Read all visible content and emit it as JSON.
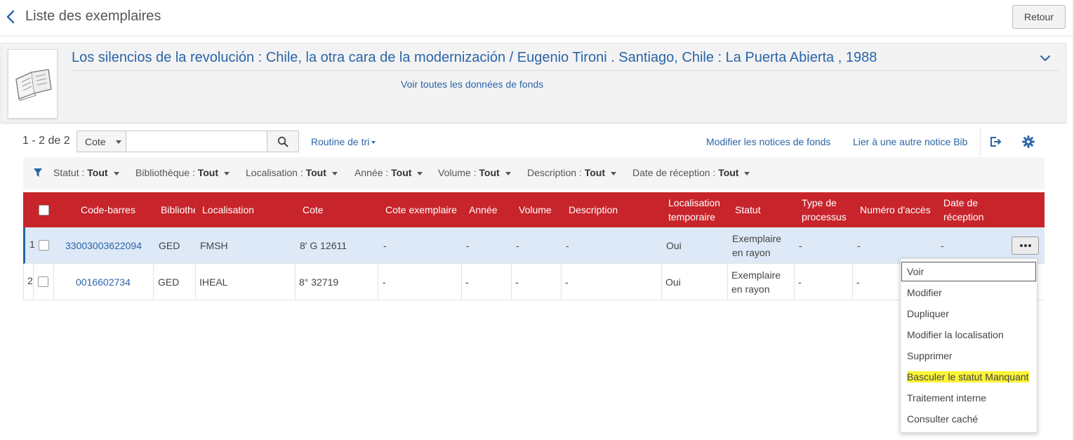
{
  "header": {
    "title": "Liste des exemplaires",
    "back_button": "Retour"
  },
  "bib": {
    "title": "Los silencios de la revolución : Chile, la otra cara de la modernización / Eugenio Tironi . Santiago, Chile : La Puerta Abierta , 1988",
    "holdings_link": "Voir toutes les données de fonds"
  },
  "toolbar": {
    "count": "1 - 2 de 2",
    "search_scope": "Cote",
    "search_value": "",
    "sort_label": "Routine de tri",
    "edit_holdings": "Modifier les notices de fonds",
    "relink": "Lier à une autre notice Bib"
  },
  "filters": [
    {
      "label": "Statut :",
      "value": "Tout"
    },
    {
      "label": "Bibliothèque :",
      "value": "Tout"
    },
    {
      "label": "Localisation :",
      "value": "Tout"
    },
    {
      "label": "Année :",
      "value": "Tout"
    },
    {
      "label": "Volume :",
      "value": "Tout"
    },
    {
      "label": "Description :",
      "value": "Tout"
    },
    {
      "label": "Date de réception :",
      "value": "Tout"
    }
  ],
  "table": {
    "columns": [
      "Code-barres",
      "Bibliothèque",
      "Localisation",
      "Cote",
      "Cote exemplaire",
      "Année",
      "Volume",
      "Description",
      "Localisation temporaire",
      "Statut",
      "Type de processus",
      "Numéro d'accès",
      "Date de réception"
    ],
    "rows": [
      {
        "num": "1",
        "barcode": "33003003622094",
        "library": "GED",
        "location": "FMSH",
        "call_number": "8' G 12611",
        "item_call": "-",
        "year": "-",
        "volume": "-",
        "description": "-",
        "temp_location": "Oui",
        "status": "Exemplaire en rayon",
        "process_type": "-",
        "access_no": "-",
        "receipt_date": "-"
      },
      {
        "num": "2",
        "barcode": "0016602734",
        "library": "GED",
        "location": "IHEAL",
        "call_number": "8° 32719",
        "item_call": "-",
        "year": "-",
        "volume": "-",
        "description": "-",
        "temp_location": "Oui",
        "status": "Exemplaire en rayon",
        "process_type": "-",
        "access_no": "-",
        "receipt_date": "-"
      }
    ]
  },
  "row_menu": {
    "items": [
      "Voir",
      "Modifier",
      "Dupliquer",
      "Modifier la localisation",
      "Supprimer",
      "Basculer le statut Manquant",
      "Traitement interne",
      "Consulter caché"
    ],
    "highlight_color": "#fbf337"
  },
  "colors": {
    "accent": "#2a65a8",
    "table_header": "#c8242b",
    "selected_row": "#dde9f7"
  },
  "icons": {
    "back": "chevron-left-icon",
    "expand": "chevron-down-icon",
    "search": "search-icon",
    "filter": "filter-icon",
    "export": "export-icon",
    "settings": "gear-icon",
    "more": "ellipsis-icon"
  }
}
